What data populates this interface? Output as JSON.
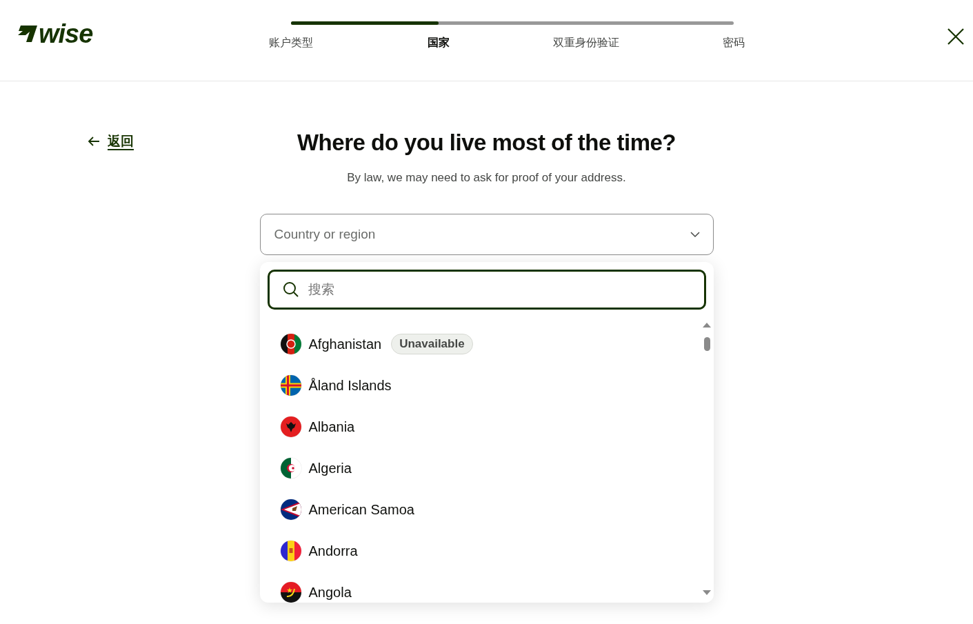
{
  "logo": {
    "text": "wise"
  },
  "steps": [
    {
      "label": "账户类型",
      "selected": false
    },
    {
      "label": "国家",
      "selected": true
    },
    {
      "label": "双重身份验证",
      "selected": false
    },
    {
      "label": "密码",
      "selected": false
    }
  ],
  "progress": {
    "level": 0.333
  },
  "back_link": {
    "label": "返回"
  },
  "title": "Where do you live most of the time?",
  "subtitle": "By law, we may need to ask for proof of your address.",
  "country_select": {
    "placeholder": "Country or region",
    "expanded": true
  },
  "search": {
    "placeholder": "搜索"
  },
  "countries": [
    {
      "name": "Afghanistan",
      "badge": "Unavailable"
    },
    {
      "name": "Åland Islands"
    },
    {
      "name": "Albania"
    },
    {
      "name": "Algeria"
    },
    {
      "name": "American Samoa"
    },
    {
      "name": "Andorra"
    },
    {
      "name": "Angola"
    }
  ]
}
